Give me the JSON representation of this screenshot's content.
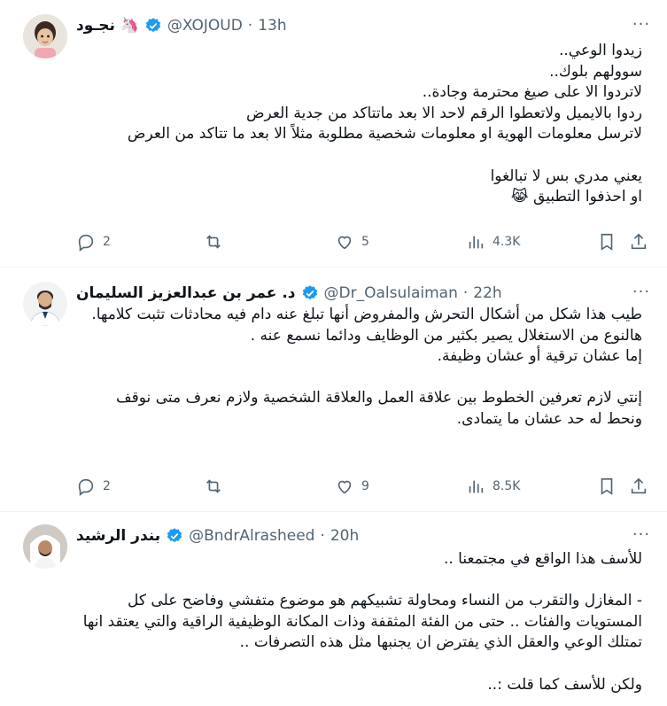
{
  "tweets": [
    {
      "name": "نجـود 🦄",
      "handle": "@XOJOUD",
      "dot": "·",
      "time": "13h",
      "text": "زيدوا الوعي..\nسوولهم بلوك..\nلاتردوا الا على صيغ محترمة وجادة..\nردوا بالايميل ولاتعطوا الرقم لاحد الا بعد ماتتاكد من جدية العرض\nلاترسل معلومات الهوية او معلومات شخصية مطلوبة مثلاً الا بعد ما تتاكد من العرض\n\nيعني مدري بس لا تبالغوا\nاو احذفوا التطبيق 😹",
      "replies": "2",
      "retweets": "",
      "likes": "5",
      "views": "4.3K"
    },
    {
      "name": "د. عمر بن عبدالعزيز السليمان",
      "handle": "@Dr_Oalsulaiman",
      "dot": "·",
      "time": "22h",
      "text": "طيب هذا شكل من أشكال التحرش والمفروض أنها تبلغ عنه دام فيه محادثات تثبت كلامها.\nهالنوع من الاستغلال يصير بكثير من الوظايف ودائما نسمع عنه .\nإما عشان ترقية أو عشان وظيفة.\n\nإنتي لازم تعرفين الخطوط بين علاقة العمل والعلاقة الشخصية ولازم نعرف متى نوقف ونحط له حد عشان ما يتمادى.",
      "replies": "2",
      "retweets": "",
      "likes": "9",
      "views": "8.5K"
    },
    {
      "name": "بندر الرشيد",
      "handle": "@BndrAlrasheed",
      "dot": "·",
      "time": "20h",
      "text": "للأسف هذا الواقع في مجتمعنا ..\n\n- المغازل والتقرب من النساء ومحاولة تشبيكهم هو موضوع متفشي وفاضح على كل المستويات والفئات .. حتى من الفئة المثقفة وذات المكانة الوظيفية الراقية والتي يعتقد انها تمتلك الوعي والعقل الذي يفترض ان يجنبها مثل هذه التصرفات ..\n\nولكن للأسف كما قلت :.."
    }
  ],
  "colors": {
    "verified": "#1d9bf0",
    "muted": "#536471",
    "text": "#0f1419"
  },
  "icons": [
    "reply-icon",
    "retweet-icon",
    "like-icon",
    "views-icon",
    "bookmark-icon",
    "share-icon",
    "more-icon",
    "verified-icon"
  ]
}
